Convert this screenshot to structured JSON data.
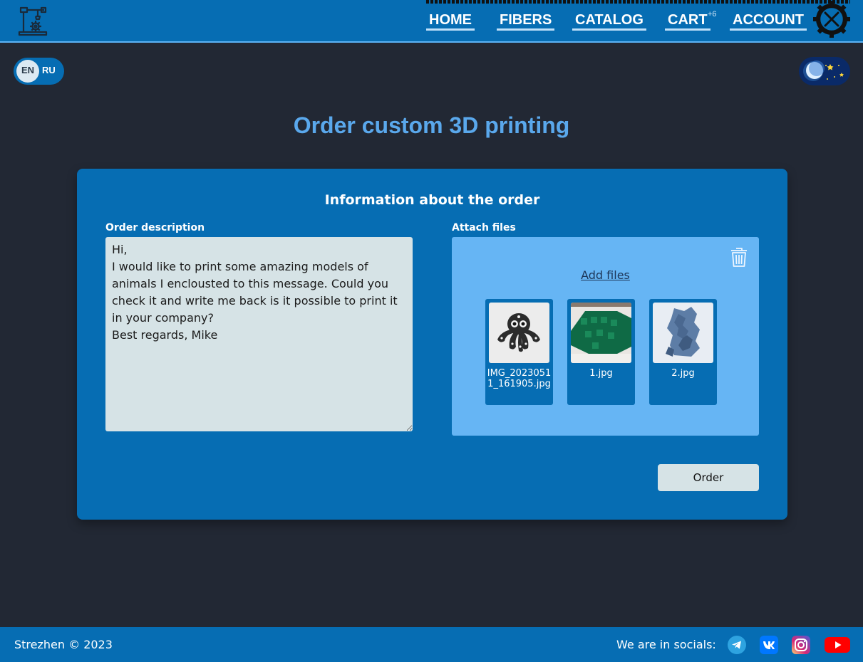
{
  "header": {
    "nav": [
      {
        "label": "HOME"
      },
      {
        "label": "FIBERS"
      },
      {
        "label": "CATALOG"
      },
      {
        "label": "CART"
      },
      {
        "label": "ACCOUNT"
      }
    ],
    "cart_count": "+6",
    "icons": {
      "logo": "robot-arm-gear-icon",
      "close": "close-circle-icon"
    }
  },
  "language": {
    "en": "EN",
    "ru": "RU",
    "selected": "EN"
  },
  "theme_toggle": {
    "mode": "dark",
    "icon": "moon-stars-icon"
  },
  "page": {
    "title": "Order custom 3D printing"
  },
  "form": {
    "title": "Information about the order",
    "description_label": "Order description",
    "description_value": "Hi,\nI would like to print some amazing models of animals I enclousted to this message. Could you check it and write me back is it possible to print it in your company?\nBest regards, Mike",
    "files_label": "Attach files",
    "add_files": "Add files",
    "files": [
      {
        "name": "IMG_20230511_161905.jpg",
        "thumb": "octopus-model"
      },
      {
        "name": "1.jpg",
        "thumb": "green-dinosaur-model"
      },
      {
        "name": "2.jpg",
        "thumb": "blue-dragon-model"
      }
    ],
    "order_button": "Order"
  },
  "footer": {
    "copyright": "Strezhen © 2023",
    "socials_label": "We are in socials:",
    "socials": [
      "telegram-icon",
      "vk-icon",
      "instagram-icon",
      "youtube-icon"
    ]
  },
  "colors": {
    "background": "#222834",
    "primary": "#066db3",
    "accent": "#5aa8ec",
    "drop_zone": "#66b5f4",
    "input_bg": "#d6e3e6"
  }
}
